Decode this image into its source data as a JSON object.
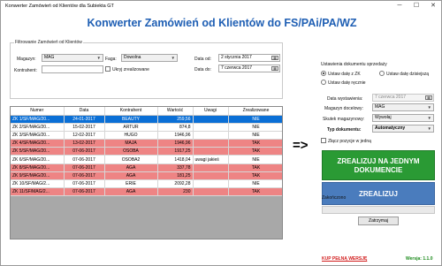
{
  "window": {
    "title": "Konwerter Zamówień od Klientów dla Subiekta GT",
    "controls": {
      "minimize": "─",
      "maximize": "☐",
      "close": "✕"
    }
  },
  "main_title": "Konwerter Zamówień od Klientów do FS/PAi/PA/WZ",
  "filters": {
    "group_label": "Filtrowanie Zamówień od Klientów",
    "magazyn_label": "Magazyn:",
    "magazyn_value": "MAG",
    "faga_label": "Faga:",
    "faga_value": "Dowolna",
    "data_od_label": "Data od:",
    "data_od_value": "2   stycznia  2017",
    "kontrahent_label": "Kontrahent:",
    "kontrahent_value": "",
    "ukryj_label": "Ukryj zrealizowane",
    "data_do_label": "Data do:",
    "data_do_value": "7   czerwca  2017"
  },
  "table": {
    "headers": [
      "Numer",
      "Data",
      "Kontrahent",
      "Wartość",
      "Uwagi",
      "Zrealizowane"
    ],
    "rows": [
      {
        "style": "sel",
        "cells": [
          "ZK 1/SF/MAG/20...",
          "24-01-2017",
          "BEAUTY",
          "259,56",
          "",
          "NIE"
        ]
      },
      {
        "style": "white",
        "cells": [
          "ZK 2/SF/MAG/20...",
          "15-02-2017",
          "ARTUR",
          "874,8",
          "",
          "NIE"
        ]
      },
      {
        "style": "white",
        "cells": [
          "ZK 3/SF/MAG/20...",
          "12-02-2017",
          "HUGO",
          "1946,96",
          "",
          "NIE"
        ]
      },
      {
        "style": "red",
        "cells": [
          "ZK 4/SF/MAG/20...",
          "13-02-2017",
          "MAJA",
          "1946,96",
          "",
          "TAK"
        ]
      },
      {
        "style": "red",
        "cells": [
          "ZK 5/SF/MAG/20...",
          "07-06-2017",
          "OSOBA",
          "1917,25",
          "",
          "TAK"
        ]
      },
      {
        "style": "white",
        "cells": [
          "ZK 6/SF/MAG/20...",
          "07-06-2017",
          "OSOBA2",
          "1418,04",
          "uwagi jakieś",
          "NIE"
        ]
      },
      {
        "style": "red",
        "cells": [
          "ZK 8/SF/MAG/20...",
          "07-06-2017",
          "AGA",
          "337,78",
          "",
          "TAK"
        ]
      },
      {
        "style": "red",
        "cells": [
          "ZK 9/SF/MAG/20...",
          "07-06-2017",
          "AGA",
          "181,25",
          "",
          "TAK"
        ]
      },
      {
        "style": "white",
        "cells": [
          "ZK 10/SF/MAG/2...",
          "07-06-2017",
          "ERIE",
          "2092,28",
          "",
          "NIE"
        ]
      },
      {
        "style": "red",
        "cells": [
          "ZK 11/SF/MAG/2...",
          "07-06-2017",
          "AGA",
          "230",
          "",
          "TAK"
        ]
      }
    ]
  },
  "arrow": "=>",
  "settings": {
    "group_label": "Ustawienia dokumentu sprzedaży",
    "radio_zk": "Ustaw datę z ZK",
    "radio_today": "Ustaw datę dzisiejszą",
    "radio_manual": "Ustaw datę ręcznie",
    "data_wystawienia_label": "Data wystawienia:",
    "data_wystawienia_value": "7   czerwca  2017",
    "magazyn_docelowy_label": "Magazyn docelowy:",
    "magazyn_docelowy_value": "MAG",
    "skutek_label": "Skutek magazynowy:",
    "skutek_value": "Wywołaj",
    "typ_label": "Typ dokumentu:",
    "typ_value": "Automatyczny",
    "scal_label": "Złącz pozycje w jedną"
  },
  "actions": {
    "realize_one_line1": "ZREALIZUJ NA JEDNYM",
    "realize_one_line2": "DOKUMENCIE",
    "realize": "ZREALIZUJ",
    "status_label": "Zakończono",
    "progress": 0,
    "stop": "Zatrzymaj"
  },
  "footer": {
    "buy_link": "KUP PEŁNĄ WERSJĘ",
    "version": "Wersja: 1.1.0"
  },
  "icons": {
    "calendar": "calendar-icon",
    "dropdown": "chevron-down-icon"
  }
}
